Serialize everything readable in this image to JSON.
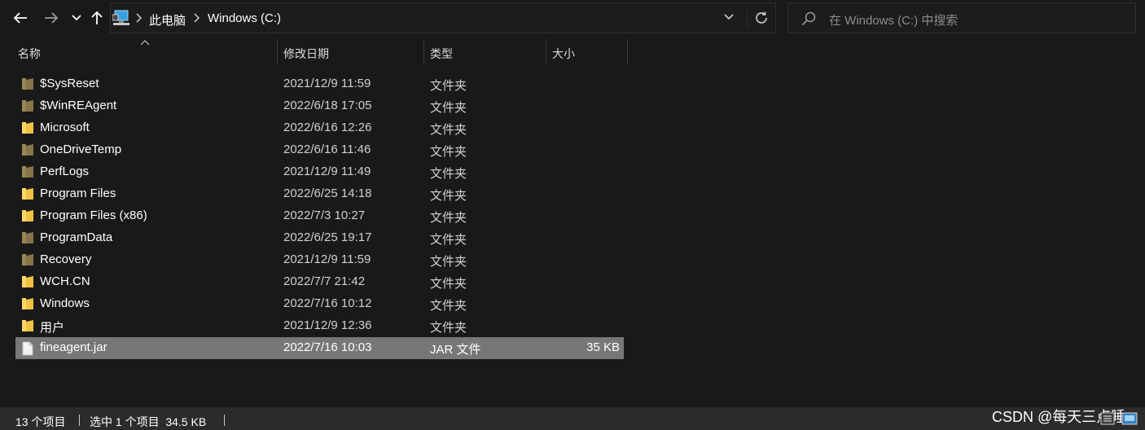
{
  "navigation": {
    "back_icon": "arrow-left-icon",
    "forward_icon": "arrow-right-icon",
    "recent_icon": "chevron-down-icon",
    "up_icon": "arrow-up-icon"
  },
  "address_bar": {
    "root_icon": "this-pc-icon",
    "breadcrumbs": [
      "此电脑",
      "Windows (C:)"
    ],
    "dropdown_icon": "chevron-down-icon",
    "refresh_icon": "refresh-icon"
  },
  "search": {
    "placeholder": "在 Windows (C:) 中搜索",
    "icon": "search-icon"
  },
  "columns": {
    "name": "名称",
    "date": "修改日期",
    "type": "类型",
    "size": "大小"
  },
  "files": [
    {
      "name": "$SysReset",
      "date": "2021/12/9 11:59",
      "type": "文件夹",
      "size": "",
      "icon": "folder-icon",
      "hidden": true
    },
    {
      "name": "$WinREAgent",
      "date": "2022/6/18 17:05",
      "type": "文件夹",
      "size": "",
      "icon": "folder-icon",
      "hidden": true
    },
    {
      "name": "Microsoft",
      "date": "2022/6/16 12:26",
      "type": "文件夹",
      "size": "",
      "icon": "folder-icon",
      "hidden": false
    },
    {
      "name": "OneDriveTemp",
      "date": "2022/6/16 11:46",
      "type": "文件夹",
      "size": "",
      "icon": "folder-icon",
      "hidden": true
    },
    {
      "name": "PerfLogs",
      "date": "2021/12/9 11:49",
      "type": "文件夹",
      "size": "",
      "icon": "folder-icon",
      "hidden": true
    },
    {
      "name": "Program Files",
      "date": "2022/6/25 14:18",
      "type": "文件夹",
      "size": "",
      "icon": "folder-icon",
      "hidden": false
    },
    {
      "name": "Program Files (x86)",
      "date": "2022/7/3 10:27",
      "type": "文件夹",
      "size": "",
      "icon": "folder-icon",
      "hidden": false
    },
    {
      "name": "ProgramData",
      "date": "2022/6/25 19:17",
      "type": "文件夹",
      "size": "",
      "icon": "folder-icon",
      "hidden": true
    },
    {
      "name": "Recovery",
      "date": "2021/12/9 11:59",
      "type": "文件夹",
      "size": "",
      "icon": "folder-icon",
      "hidden": true
    },
    {
      "name": "WCH.CN",
      "date": "2022/7/7 21:42",
      "type": "文件夹",
      "size": "",
      "icon": "folder-icon",
      "hidden": false
    },
    {
      "name": "Windows",
      "date": "2022/7/16 10:12",
      "type": "文件夹",
      "size": "",
      "icon": "folder-icon",
      "hidden": false
    },
    {
      "name": "用户",
      "date": "2021/12/9 12:36",
      "type": "文件夹",
      "size": "",
      "icon": "folder-icon",
      "hidden": false
    },
    {
      "name": "fineagent.jar",
      "date": "2022/7/16 10:03",
      "type": "JAR 文件",
      "size": "35 KB",
      "icon": "file-icon",
      "hidden": false,
      "selected": true
    }
  ],
  "status": {
    "item_count": "13 个项目",
    "selection": "选中 1 个项目  34.5 KB"
  },
  "watermark": "CSDN @每天三点睡",
  "view_icons": [
    "details-view-icon",
    "large-icons-view-icon"
  ],
  "colors": {
    "background": "#191919",
    "folder": "#ffd766",
    "folder_hidden": "#9a8654",
    "selection": "#777777",
    "statusbar": "#2b2b2b"
  }
}
